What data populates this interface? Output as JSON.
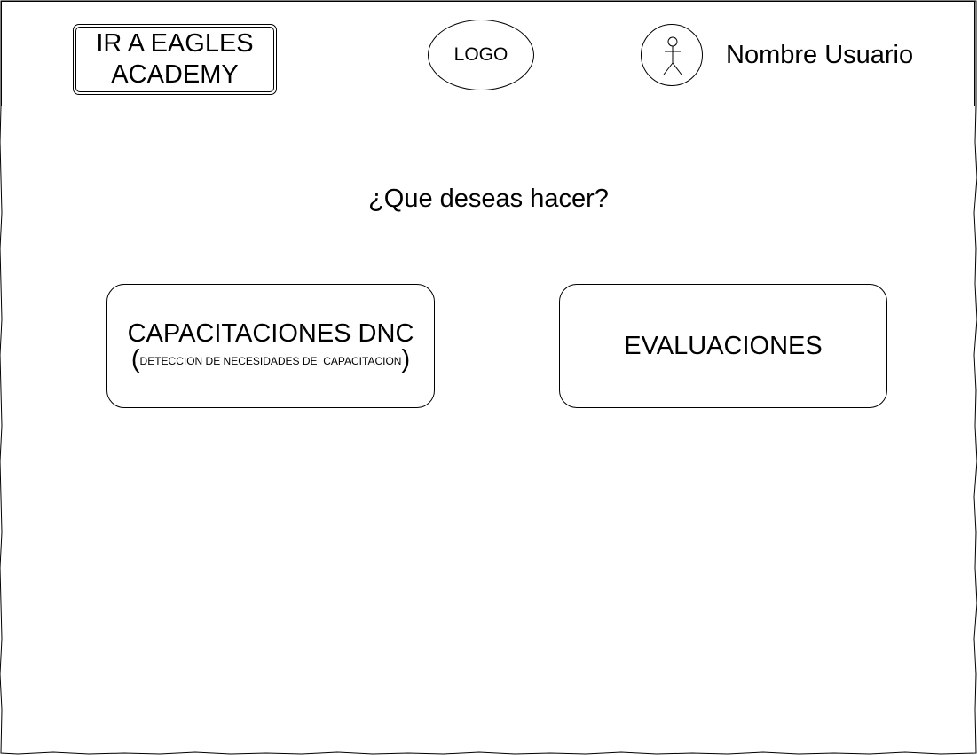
{
  "header": {
    "academy_button_label": "IR A EAGLES\nACADEMY",
    "logo_label": "LOGO",
    "avatar_icon": "person-icon",
    "user_name": "Nombre Usuario"
  },
  "main": {
    "question": "¿Que deseas hacer?",
    "options": [
      {
        "title": "CAPACITACIONES DNC",
        "subtitle_open": "(",
        "subtitle": "DETECCION DE NECESIDADES DE  CAPACITACION",
        "subtitle_close": ")"
      },
      {
        "title": "EVALUACIONES"
      }
    ]
  }
}
